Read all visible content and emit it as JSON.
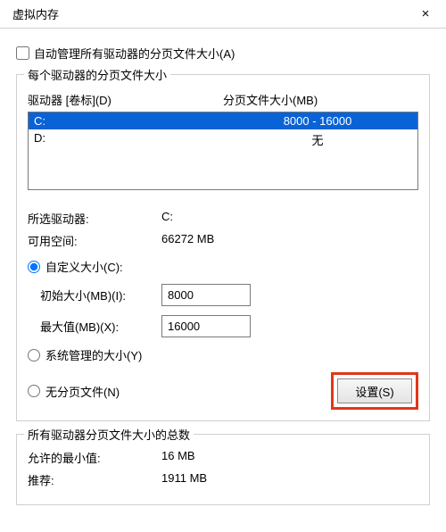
{
  "window": {
    "title": "虚拟内存",
    "close": "×"
  },
  "automanage": {
    "label": "自动管理所有驱动器的分页文件大小(A)",
    "checked": false
  },
  "group1": {
    "title": "每个驱动器的分页文件大小",
    "col_drive": "驱动器  [卷标](D)",
    "col_size": "分页文件大小(MB)",
    "rows": [
      {
        "drive": "C:",
        "size": "8000 - 16000",
        "selected": true
      },
      {
        "drive": "D:",
        "size": "无",
        "selected": false
      }
    ],
    "selected_drive_label": "所选驱动器:",
    "selected_drive_value": "C:",
    "free_space_label": "可用空间:",
    "free_space_value": "66272 MB",
    "custom_label": "自定义大小(C):",
    "initial_label": "初始大小(MB)(I):",
    "initial_value": "8000",
    "max_label": "最大值(MB)(X):",
    "max_value": "16000",
    "system_label": "系统管理的大小(Y)",
    "none_label": "无分页文件(N)",
    "set_btn": "设置(S)"
  },
  "group2": {
    "title": "所有驱动器分页文件大小的总数",
    "min_label": "允许的最小值:",
    "min_value": "16 MB",
    "rec_label": "推荐:",
    "rec_value": "1911 MB"
  }
}
